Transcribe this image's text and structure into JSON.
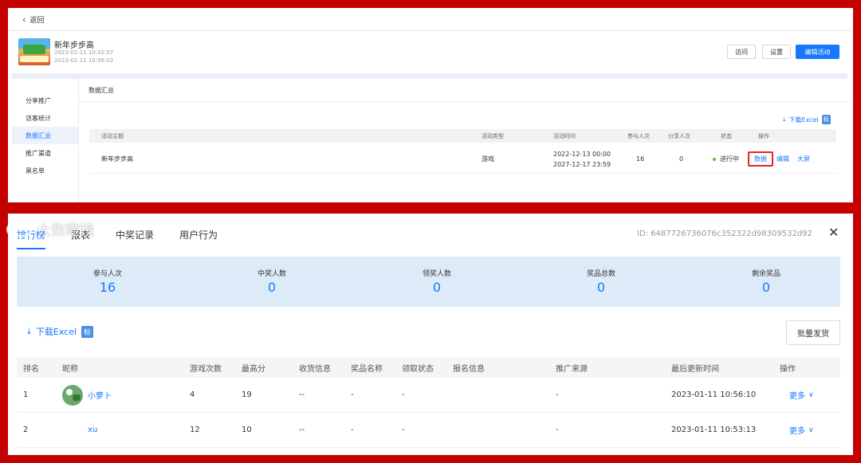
{
  "top": {
    "back_label": "返回",
    "activity": {
      "title": "新年步步高",
      "date1": "2023-01-11 10:32:57",
      "date2": "2023-01-11 10:56:02"
    },
    "buttons": {
      "visit": "访问",
      "settings": "设置",
      "edit": "编辑活动"
    },
    "nav": [
      "分享推广",
      "访客统计",
      "数据汇总",
      "推广渠道",
      "黑名单"
    ],
    "active_nav": "数据汇总",
    "section_title": "数据汇总",
    "download_excel": "下载Excel",
    "tag": "标",
    "table": {
      "headers": [
        "活动主题",
        "活动类型",
        "活动时间",
        "参与人次",
        "分享人次",
        "状态",
        "操作"
      ],
      "row": {
        "theme": "新年步步高",
        "type": "游戏",
        "time_start": "2022-12-13 00:00",
        "time_end": "2027-12-17 23:59",
        "participants": "16",
        "shares": "0",
        "status": "进行中",
        "status_color": "#52c41a",
        "actions": [
          "数据",
          "编辑",
          "大屏"
        ]
      }
    }
  },
  "bottom": {
    "tabs": [
      "排行榜",
      "报表",
      "中奖记录",
      "用户行为"
    ],
    "active_tab": "排行榜",
    "id_text": "ID: 6487726736076c352322d98309532d92",
    "stats": [
      {
        "label": "参与人次",
        "value": "16"
      },
      {
        "label": "中奖人数",
        "value": "0"
      },
      {
        "label": "领奖人数",
        "value": "0"
      },
      {
        "label": "奖品总数",
        "value": "0"
      },
      {
        "label": "剩余奖品",
        "value": "0"
      }
    ],
    "download_excel": "下载Excel",
    "tag": "标",
    "batch_ship": "批量发货",
    "table": {
      "headers": [
        "排名",
        "昵称",
        "游戏次数",
        "最高分",
        "收货信息",
        "奖品名称",
        "领取状态",
        "报名信息",
        "推广来源",
        "最后更新时间",
        "操作"
      ],
      "rows": [
        {
          "rank": "1",
          "nickname": "小萝卜",
          "plays": "4",
          "best": "19",
          "address": "--",
          "prize": "-",
          "claim": "-",
          "signup": "",
          "source": "-",
          "updated": "2023-01-11 10:56:10",
          "action": "更多"
        },
        {
          "rank": "2",
          "nickname": "xu",
          "plays": "12",
          "best": "10",
          "address": "--",
          "prize": "-",
          "claim": "-",
          "signup": "",
          "source": "-",
          "updated": "2023-01-11 10:53:13",
          "action": "更多"
        }
      ]
    }
  },
  "watermark": "大数瞪镜",
  "accent": "#1677ff",
  "frame_color": "#c40000"
}
